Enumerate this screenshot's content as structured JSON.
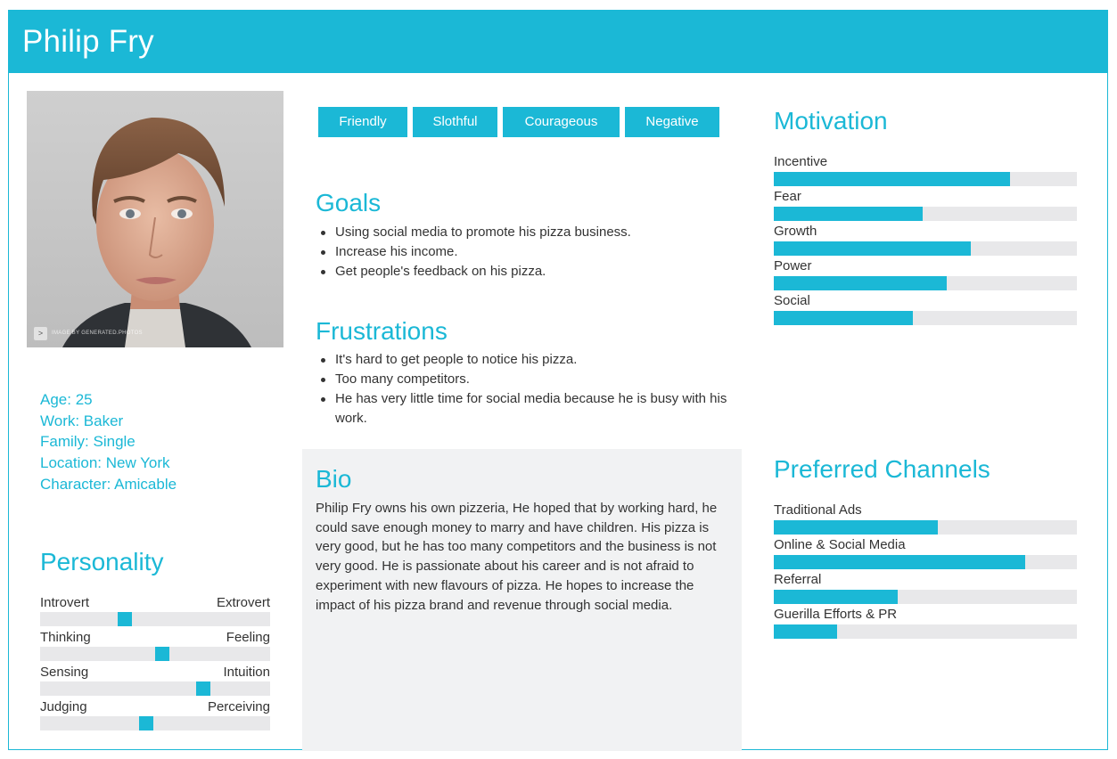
{
  "persona": {
    "name": "Philip Fry",
    "photo_watermark": "IMAGE BY GENERATED.PHOTOS",
    "facts": [
      "Age: 25",
      "Work: Baker",
      "Family: Single",
      "Location: New York",
      "Character: Amicable"
    ]
  },
  "traits": [
    "Friendly",
    "Slothful",
    "Courageous",
    "Negative"
  ],
  "goals": {
    "title": "Goals",
    "items": [
      "Using social media to promote his pizza business.",
      "Increase his income.",
      "Get people's feedback on his pizza."
    ]
  },
  "frustrations": {
    "title": "Frustrations",
    "items": [
      "It's hard to get people to notice his pizza.",
      "Too many competitors.",
      "He has very little time for social media because he is busy with his work."
    ]
  },
  "bio": {
    "title": "Bio",
    "text": "Philip Fry owns his own pizzeria, He hoped that by working hard, he could save enough money to marry and have children. His pizza is very good, but he has too many competitors and the business is not very good. He is passionate about his career and is not afraid to experiment with new flavours of pizza. He hopes to increase the impact of his pizza brand and revenue through social media."
  },
  "personality": {
    "title": "Personality",
    "scales": [
      {
        "left": "Introvert",
        "right": "Extrovert",
        "value": 0.37
      },
      {
        "left": "Thinking",
        "right": "Feeling",
        "value": 0.53
      },
      {
        "left": "Sensing",
        "right": "Intuition",
        "value": 0.71
      },
      {
        "left": "Judging",
        "right": "Perceiving",
        "value": 0.46
      }
    ]
  },
  "motivation": {
    "title": "Motivation",
    "items": [
      {
        "label": "Incentive",
        "value": 0.78
      },
      {
        "label": "Fear",
        "value": 0.49
      },
      {
        "label": "Growth",
        "value": 0.65
      },
      {
        "label": "Power",
        "value": 0.57
      },
      {
        "label": "Social",
        "value": 0.46
      }
    ]
  },
  "channels": {
    "title": "Preferred Channels",
    "items": [
      {
        "label": "Traditional Ads",
        "value": 0.54
      },
      {
        "label": "Online & Social Media",
        "value": 0.83
      },
      {
        "label": "Referral",
        "value": 0.41
      },
      {
        "label": "Guerilla Efforts & PR",
        "value": 0.21
      }
    ]
  },
  "colors": {
    "accent": "#1bb8d6",
    "track": "#e8e8ea",
    "bio_bg": "#f1f2f3"
  }
}
